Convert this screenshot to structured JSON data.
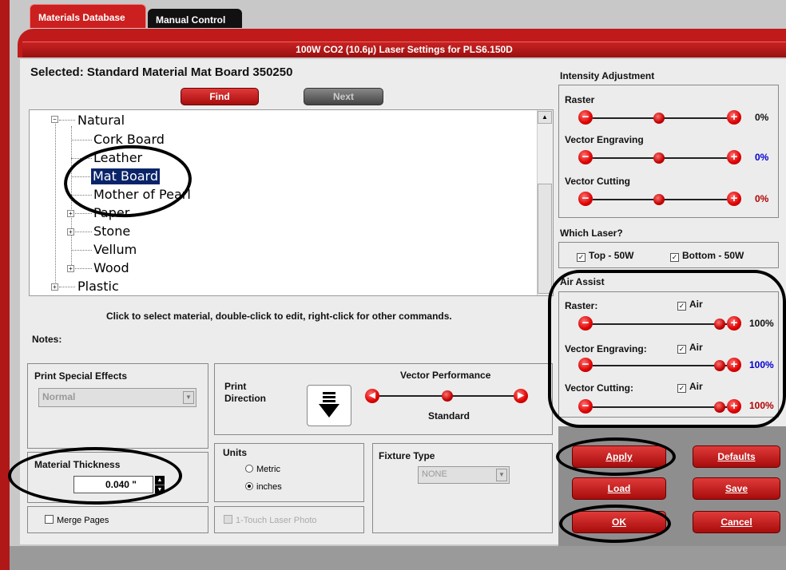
{
  "tabs": [
    {
      "label": "Materials Database"
    },
    {
      "label": "Manual Control"
    }
  ],
  "title": "100W CO2 (10.6µ) Laser Settings for PLS6.150D",
  "selected_text": "Selected: Standard Material Mat Board 350250",
  "buttons": {
    "find": "Find",
    "next": "Next",
    "apply": "Apply",
    "defaults": "Defaults",
    "load": "Load",
    "save": "Save",
    "ok": "OK",
    "cancel": "Cancel"
  },
  "tree": {
    "items": [
      "Natural",
      "Cork Board",
      "Leather",
      "Mat Board",
      "Mother of Pearl",
      "Paper",
      "Stone",
      "Vellum",
      "Wood",
      "Plastic"
    ]
  },
  "hint": "Click to select material, double-click to edit, right-click for other commands.",
  "notes_label": "Notes:",
  "print_special_effects": {
    "label": "Print Special Effects",
    "value": "Normal"
  },
  "print_direction": {
    "label_line1": "Print",
    "label_line2": "Direction"
  },
  "vector_performance": {
    "label": "Vector Performance",
    "value": "Standard"
  },
  "material_thickness": {
    "label": "Material Thickness",
    "value": "0.040 \""
  },
  "units": {
    "label": "Units",
    "options": [
      "Metric",
      "inches"
    ],
    "selected": "inches"
  },
  "fixture_type": {
    "label": "Fixture Type",
    "value": "NONE"
  },
  "merge_pages": "Merge Pages",
  "one_touch": "1-Touch Laser Photo",
  "intensity": {
    "label": "Intensity Adjustment",
    "raster": {
      "label": "Raster",
      "value": "0%"
    },
    "vector_engraving": {
      "label": "Vector Engraving",
      "value": "0%"
    },
    "vector_cutting": {
      "label": "Vector Cutting",
      "value": "0%"
    }
  },
  "which_laser": {
    "label": "Which Laser?",
    "top": "Top - 50W",
    "bottom": "Bottom - 50W"
  },
  "air_assist": {
    "label": "Air Assist",
    "air": "Air",
    "raster": {
      "label": "Raster:",
      "value": "100%"
    },
    "vector_engraving": {
      "label": "Vector Engraving:",
      "value": "100%"
    },
    "vector_cutting": {
      "label": "Vector Cutting:",
      "value": "100%"
    }
  },
  "colors": {
    "accent_red": "#c11a1a",
    "blue_value": "#0000cc",
    "red_value": "#b00000"
  }
}
